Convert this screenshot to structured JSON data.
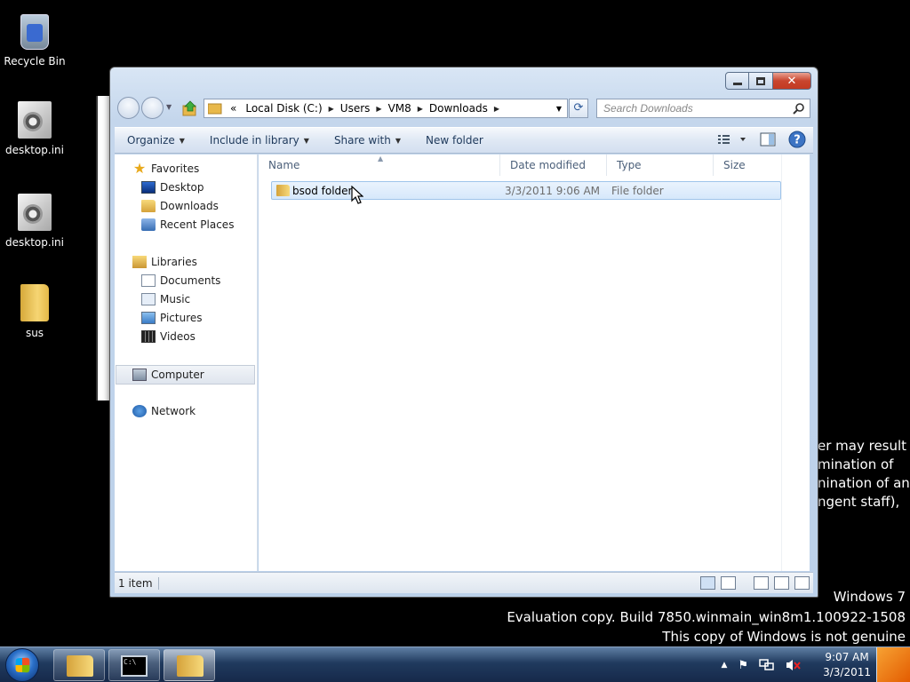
{
  "desktop": {
    "icons": [
      {
        "label": "Recycle Bin",
        "icon": "recycle-bin-icon"
      },
      {
        "label": "desktop.ini",
        "icon": "settings-file-icon"
      },
      {
        "label": "desktop.ini",
        "icon": "settings-file-icon"
      },
      {
        "label": "sus",
        "icon": "folder-icon"
      }
    ],
    "eula_lines": [
      "er may result",
      "mination of",
      "nination of an",
      "ngent staff),"
    ],
    "watermark": {
      "line1": "Windows 7",
      "line2": "Evaluation copy. Build 7850.winmain_win8m1.100922-1508",
      "line3": "This copy of Windows is not genuine"
    }
  },
  "explorer": {
    "breadcrumb": {
      "overflow": "«",
      "items": [
        "Local Disk (C:)",
        "Users",
        "VM8",
        "Downloads"
      ]
    },
    "search": {
      "placeholder": "Search Downloads"
    },
    "toolbar": {
      "organize": "Organize",
      "include_in_library": "Include in library",
      "share_with": "Share with",
      "new_folder": "New folder"
    },
    "nav_pane": {
      "favorites": {
        "label": "Favorites",
        "items": [
          "Desktop",
          "Downloads",
          "Recent Places"
        ]
      },
      "libraries": {
        "label": "Libraries",
        "items": [
          "Documents",
          "Music",
          "Pictures",
          "Videos"
        ]
      },
      "computer": "Computer",
      "network": "Network"
    },
    "columns": [
      "Name",
      "Date modified",
      "Type",
      "Size"
    ],
    "files": [
      {
        "name": "bsod folder",
        "date_modified": "3/3/2011 9:06 AM",
        "type": "File folder",
        "size": ""
      }
    ],
    "status": {
      "item_count": "1 item"
    }
  },
  "taskbar": {
    "clock": {
      "time": "9:07 AM",
      "date": "3/3/2011"
    }
  },
  "colors": {
    "accent": "#3a7cc6",
    "selection": "#d6e8fb",
    "taskbar": "#203a5e"
  }
}
